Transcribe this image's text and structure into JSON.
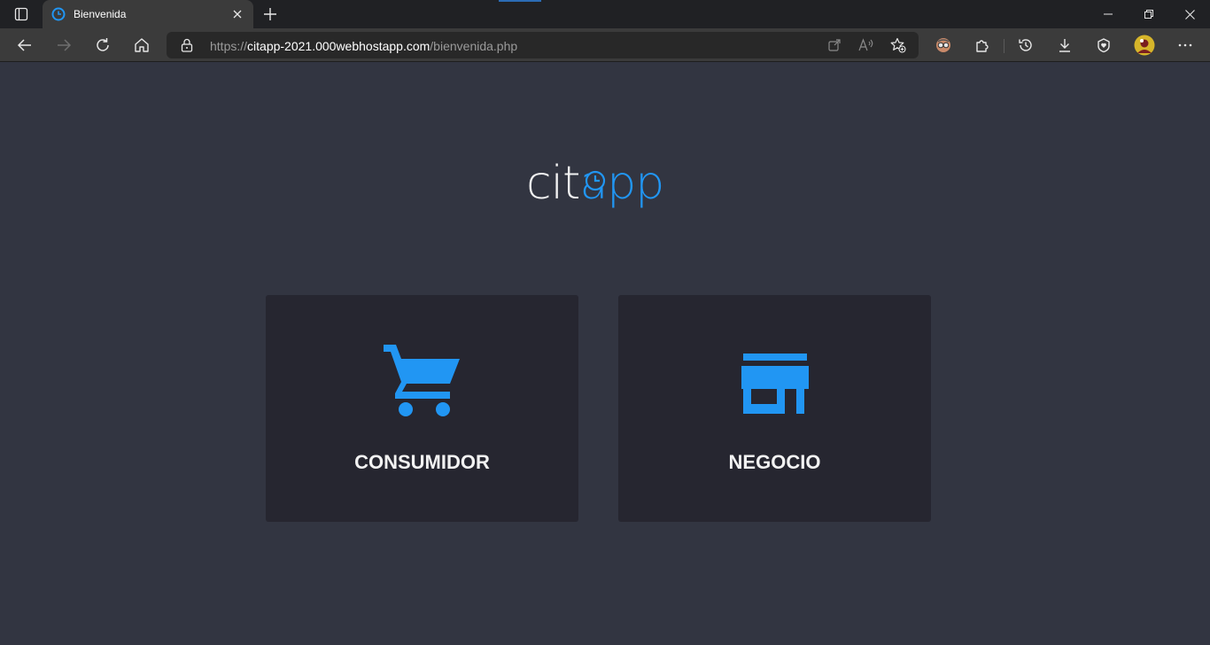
{
  "browser": {
    "tab": {
      "title": "Bienvenida"
    },
    "url": {
      "scheme": "https://",
      "host": "citapp-2021.000webhostapp.com",
      "path": "/bienvenida.php"
    },
    "accent_color": "#2196f3"
  },
  "page": {
    "logo": {
      "part1": "cit",
      "part2": "app"
    },
    "cards": [
      {
        "label": "CONSUMIDOR",
        "icon": "shopping-cart-icon"
      },
      {
        "label": "NEGOCIO",
        "icon": "store-icon"
      }
    ],
    "colors": {
      "background": "#323541",
      "card": "#262630",
      "accent": "#2196f3",
      "text": "#f2f2f2"
    }
  }
}
